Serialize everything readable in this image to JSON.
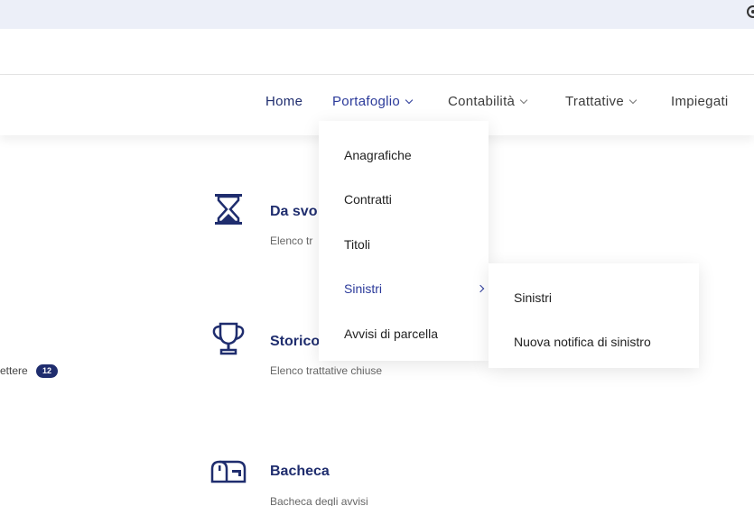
{
  "nav": {
    "home": "Home",
    "portafoglio": "Portafoglio",
    "contabilita": "Contabilità",
    "trattative": "Trattative",
    "impiegati": "Impiegati"
  },
  "dropdown": {
    "items": [
      "Anagrafiche",
      "Contratti",
      "Titoli",
      "Sinistri",
      "Avvisi di parcella"
    ]
  },
  "submenu": {
    "items": [
      "Sinistri",
      "Nuova notifica di sinistro"
    ]
  },
  "cards": [
    {
      "title": "Da svo",
      "desc": "Elenco tr",
      "icon": "hourglass-icon"
    },
    {
      "title": "Storico",
      "desc": "Elenco trattative chiuse",
      "icon": "trophy-icon"
    },
    {
      "title": "Bacheca",
      "desc": "Bacheca degli avvisi",
      "icon": "mailbox-icon"
    }
  ],
  "left": {
    "label": "ettere",
    "badge": "12"
  },
  "colors": {
    "brand": "#1f2d6e",
    "accent": "#2b3a9a",
    "topbar": "#eceff8"
  }
}
